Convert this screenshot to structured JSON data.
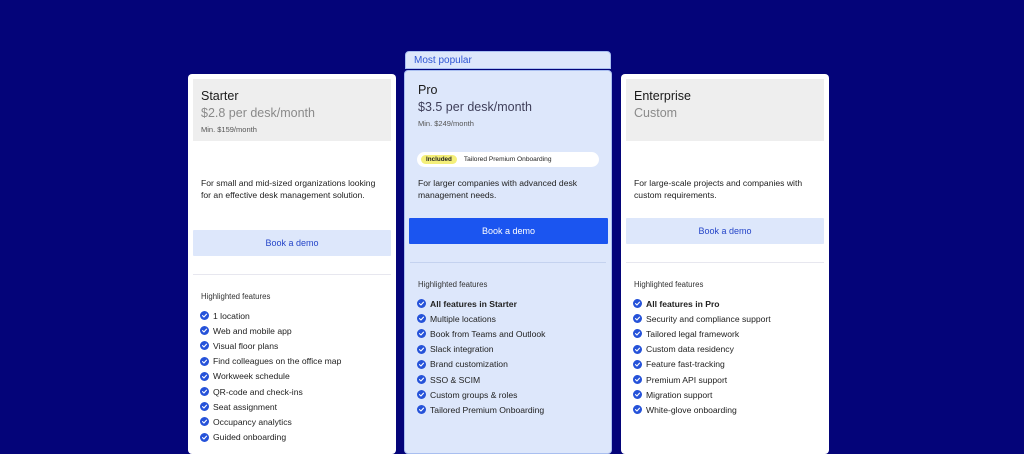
{
  "colors": {
    "background": "#040479",
    "accent": "#1b55f0",
    "check": "#2552d9",
    "pro_card": "#dde7fb",
    "included_badge": "#f4ef7a"
  },
  "most_popular_label": "Most popular",
  "features_heading": "Highlighted features",
  "plans": [
    {
      "name": "Starter",
      "price": "$2.8 per desk/month",
      "min": "Min. $159/month",
      "description": "For small and mid-sized organizations looking for an effective desk management solution.",
      "cta": "Book a demo",
      "features": [
        "1 location",
        "Web and mobile app",
        "Visual floor plans",
        "Find colleagues on the office map",
        "Workweek schedule",
        "QR-code and check-ins",
        "Seat assignment",
        "Occupancy analytics",
        "Guided onboarding"
      ]
    },
    {
      "name": "Pro",
      "price": "$3.5 per desk/month",
      "min": "Min. $249/month",
      "included_badge": "Included",
      "included_text": "Tailored Premium Onboarding",
      "description": "For larger companies with advanced desk management needs.",
      "cta": "Book a demo",
      "features": [
        "All features in Starter",
        "Multiple locations",
        "Book from Teams and Outlook",
        "Slack integration",
        "Brand customization",
        "SSO & SCIM",
        "Custom groups & roles",
        "Tailored Premium Onboarding"
      ]
    },
    {
      "name": "Enterprise",
      "price": "Custom",
      "description": "For large-scale projects and companies with custom requirements.",
      "cta": "Book a demo",
      "features": [
        "All features in Pro",
        "Security and compliance support",
        "Tailored legal framework",
        "Custom data residency",
        "Feature fast-tracking",
        "Premium API support",
        "Migration support",
        "White-glove onboarding"
      ]
    }
  ]
}
